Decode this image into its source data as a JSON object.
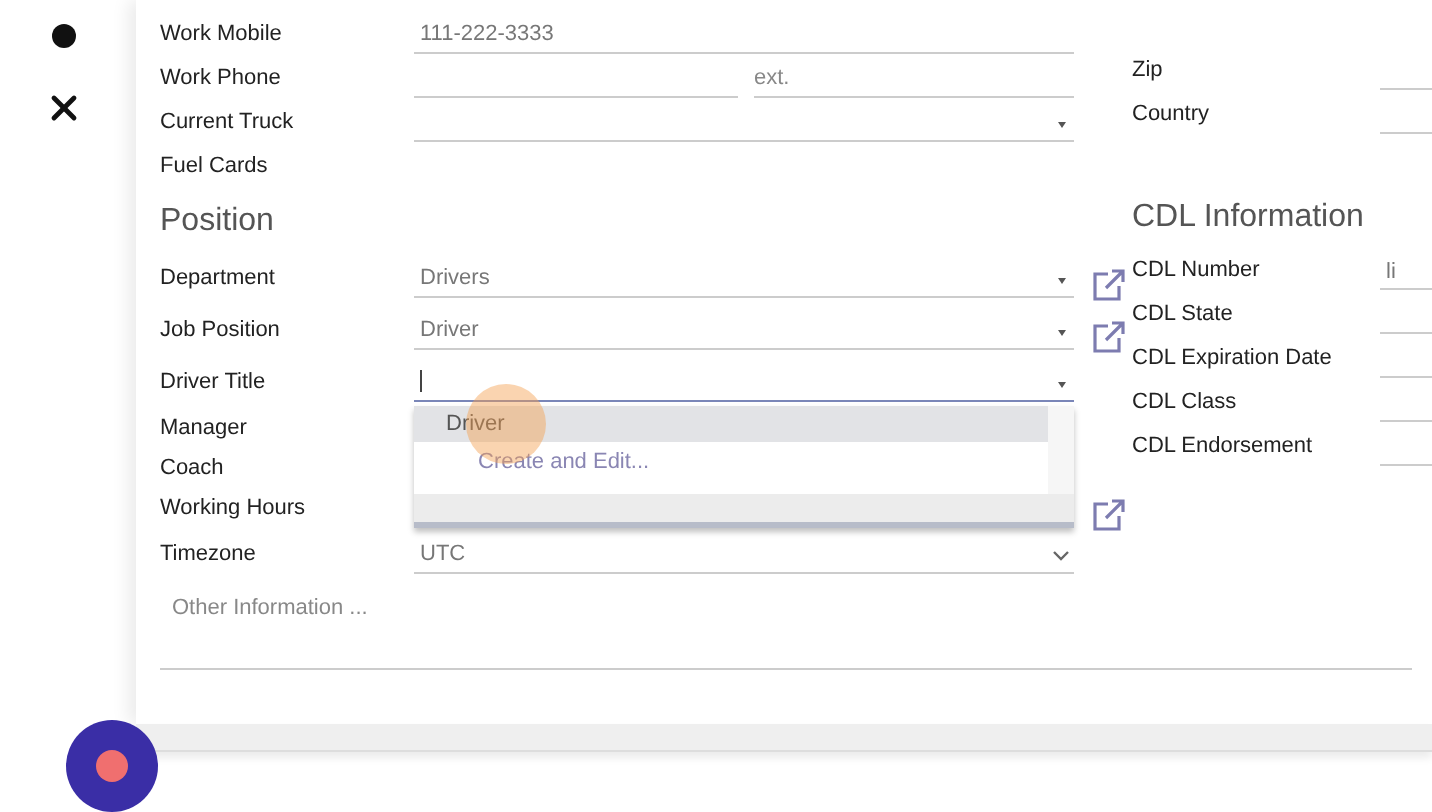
{
  "top_fields": [
    {
      "label": "Work Mobile",
      "kind": "text",
      "value": "111-222-3333"
    },
    {
      "label": "Work Phone",
      "kind": "phone",
      "ext_placeholder": "ext."
    },
    {
      "label": "Current Truck",
      "kind": "select"
    },
    {
      "label": "Fuel Cards",
      "kind": "none"
    }
  ],
  "position": {
    "heading": "Position",
    "fields": [
      {
        "label": "Department",
        "kind": "select",
        "value": "Drivers",
        "external_link": true
      },
      {
        "label": "Job Position",
        "kind": "select",
        "value": "Driver",
        "external_link": true
      },
      {
        "label": "Driver Title",
        "kind": "select",
        "focused": true
      },
      {
        "label": "Manager",
        "kind": "none"
      },
      {
        "label": "Coach",
        "kind": "none"
      },
      {
        "label": "Working Hours",
        "kind": "none",
        "external_link": true
      },
      {
        "label": "Timezone",
        "kind": "native_select",
        "value": "UTC"
      }
    ]
  },
  "dropdown": {
    "options": [
      {
        "label": "Driver",
        "selected": true
      }
    ],
    "create_label": "Create and Edit..."
  },
  "other_info_placeholder": "Other Information ...",
  "address_fields": [
    {
      "label": "Zip"
    },
    {
      "label": "Country"
    }
  ],
  "cdl": {
    "heading": "CDL Information",
    "fields": [
      {
        "label": "CDL Number",
        "value": "li"
      },
      {
        "label": "CDL State"
      },
      {
        "label": "CDL Expiration Date"
      },
      {
        "label": "CDL Class"
      },
      {
        "label": "CDL Endorsement"
      }
    ]
  }
}
